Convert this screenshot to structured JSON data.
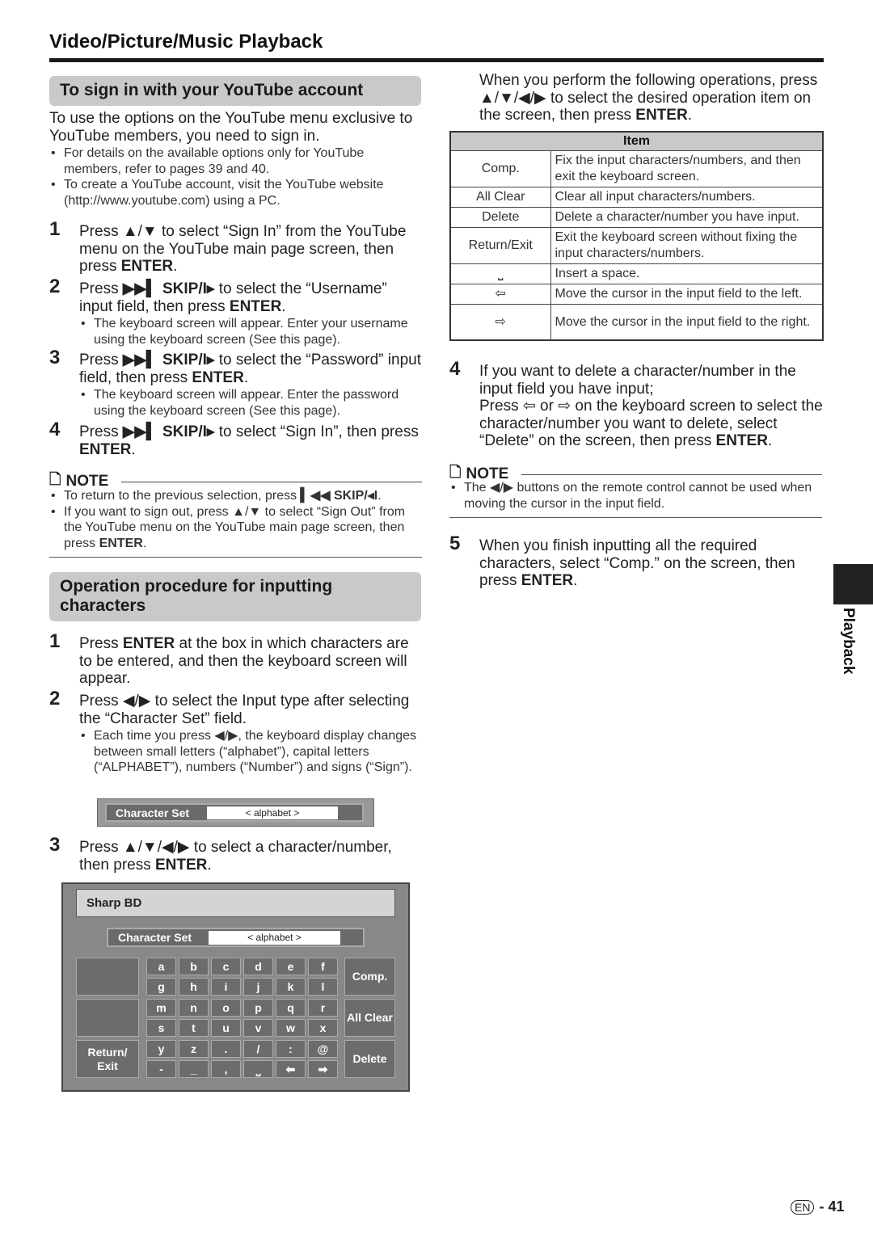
{
  "header": {
    "title": "Video/Picture/Music Playback"
  },
  "youtube": {
    "heading": "To sign in with your YouTube account",
    "intro": "To use the options on the YouTube menu exclusive to YouTube members, you need to sign in.",
    "bullets": [
      "For details on the available options only for YouTube members, refer to pages 39 and 40.",
      "To create a YouTube account, visit the YouTube website (http://www.youtube.com) using a PC."
    ],
    "steps": [
      {
        "num": "1",
        "text": [
          {
            "t": "Press ▲/▼ to select “Sign In” from the YouTube menu on the YouTube main page screen, then press "
          },
          {
            "t": "ENTER",
            "b": 1
          },
          {
            "t": "."
          }
        ],
        "bullets": []
      },
      {
        "num": "2",
        "text": [
          {
            "t": "Press "
          },
          {
            "t": "▶▶▍ SKIP/I▸",
            "b": 1
          },
          {
            "t": " to select the “Username” input field, then press "
          },
          {
            "t": "ENTER",
            "b": 1
          },
          {
            "t": "."
          }
        ],
        "bullets": [
          "The keyboard screen will appear. Enter your username using the keyboard screen (See this page)."
        ]
      },
      {
        "num": "3",
        "text": [
          {
            "t": "Press "
          },
          {
            "t": "▶▶▍ SKIP/I▸",
            "b": 1
          },
          {
            "t": " to select the “Password” input field, then press "
          },
          {
            "t": "ENTER",
            "b": 1
          },
          {
            "t": "."
          }
        ],
        "bullets": [
          "The keyboard screen will appear. Enter the password using the keyboard screen (See this page)."
        ]
      },
      {
        "num": "4",
        "text": [
          {
            "t": "Press "
          },
          {
            "t": "▶▶▍ SKIP/I▸",
            "b": 1
          },
          {
            "t": " to select “Sign In”, then press "
          },
          {
            "t": "ENTER",
            "b": 1
          },
          {
            "t": "."
          }
        ],
        "bullets": []
      }
    ],
    "note_label": "NOTE",
    "notes": [
      [
        {
          "t": "To return to the previous selection, press "
        },
        {
          "t": "▍◀◀ SKIP/◂I",
          "b": 1
        },
        {
          "t": "."
        }
      ],
      [
        {
          "t": "If you want to sign out, press ▲/▼ to select “Sign Out” from the YouTube menu on the YouTube main page screen, then press "
        },
        {
          "t": "ENTER",
          "b": 1
        },
        {
          "t": "."
        }
      ]
    ]
  },
  "input": {
    "heading": "Operation procedure for inputting characters",
    "steps": [
      {
        "num": "1",
        "text": [
          {
            "t": "Press "
          },
          {
            "t": "ENTER",
            "b": 1
          },
          {
            "t": " at the box in which characters are to be entered, and then the keyboard screen will appear."
          }
        ],
        "bullets": []
      },
      {
        "num": "2",
        "text": [
          {
            "t": "Press ◀/▶ to select the Input type after selecting the “Character Set” field."
          }
        ],
        "bullets": [
          "Each time you press ◀/▶, the keyboard display changes between small letters (“alphabet”), capital letters (“ALPHABET”), numbers (“Number”) and signs (“Sign”)."
        ]
      },
      {
        "num": "3",
        "text": [
          {
            "t": "Press ▲/▼/◀/▶ to select a character/number, then press "
          },
          {
            "t": "ENTER",
            "b": 1
          },
          {
            "t": "."
          }
        ],
        "bullets": []
      }
    ],
    "charset_label": "Character Set",
    "charset_value": "<  alphabet  >"
  },
  "keyboard": {
    "input_value": "Sharp BD",
    "charset_label": "Character Set",
    "charset_value": "<  alphabet  >",
    "keys": [
      "a",
      "b",
      "c",
      "d",
      "e",
      "f",
      "g",
      "h",
      "i",
      "j",
      "k",
      "l",
      "m",
      "n",
      "o",
      "p",
      "q",
      "r",
      "s",
      "t",
      "u",
      "v",
      "w",
      "x",
      "y",
      "z",
      ".",
      "/",
      ":",
      "@",
      "-",
      "_",
      ",",
      "⎵",
      "⬅",
      "➡"
    ],
    "left_keys": [
      "",
      "",
      "Return/ Exit"
    ],
    "right_keys": [
      "Comp.",
      "All Clear",
      "Delete"
    ]
  },
  "right": {
    "intro": "When you perform the following operations, press ▲/▼/◀/▶ to select the desired operation item on the screen, then press ",
    "intro_bold": "ENTER",
    "intro_end": ".",
    "table": {
      "header": "Item",
      "rows": [
        [
          "Comp.",
          "Fix the input characters/numbers, and then exit the keyboard screen."
        ],
        [
          "All Clear",
          "Clear all input characters/numbers."
        ],
        [
          "Delete",
          "Delete a character/number you have input."
        ],
        [
          "Return/Exit",
          "Exit the keyboard screen without fixing the input characters/numbers."
        ],
        [
          "⎵",
          "Insert a space."
        ],
        [
          "⇦",
          "Move the cursor in the input field to the left."
        ],
        [
          "⇨",
          "Move the cursor in the input field to the right."
        ]
      ]
    },
    "steps": [
      {
        "num": "4",
        "text": [
          {
            "t": "If you want to delete a character/number in the input field you have input;\nPress ⇦ or ⇨ on the keyboard screen to select the character/number you want to delete, select “Delete” on the screen, then press "
          },
          {
            "t": "ENTER",
            "b": 1
          },
          {
            "t": "."
          }
        ],
        "bullets": []
      },
      {
        "num": "5",
        "text": [
          {
            "t": "When you finish inputting all the required characters, select “Comp.” on the screen, then press "
          },
          {
            "t": "ENTER",
            "b": 1
          },
          {
            "t": "."
          }
        ],
        "bullets": []
      }
    ],
    "note_label": "NOTE",
    "notes": [
      [
        {
          "t": "The ◀/▶ buttons on the remote control cannot be used when moving the cursor in the input field."
        }
      ]
    ]
  },
  "side_tab": "Playback",
  "footer": {
    "lang": "EN",
    "page": "- 41"
  }
}
